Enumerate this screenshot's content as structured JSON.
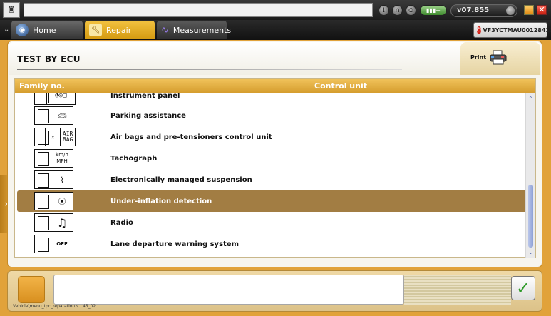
{
  "topbar": {
    "version": "v07.855",
    "close_glyph": "✕"
  },
  "nav": {
    "tabs": [
      {
        "label": "Home"
      },
      {
        "label": "Repair"
      },
      {
        "label": "Measurements"
      }
    ],
    "vin": "VF3YCTMAU00128417"
  },
  "main": {
    "title": "TEST BY ECU",
    "print_label": "Print",
    "columns": [
      "Family no.",
      "Control unit"
    ],
    "rows": [
      {
        "label": "Instrument panel",
        "icon": "instrument-gauge-icon",
        "selected": false
      },
      {
        "label": "Parking assistance",
        "icon": "parking-car-icon",
        "selected": false
      },
      {
        "label": "Air bags and pre-tensioners control unit",
        "icon": "airbag-seat-icon",
        "icon_text": "AIR BAG",
        "selected": false
      },
      {
        "label": "Tachograph",
        "icon": "tachograph-icon",
        "icon_text": "km/h MPH",
        "selected": false
      },
      {
        "label": "Electronically managed suspension",
        "icon": "suspension-spring-icon",
        "selected": false
      },
      {
        "label": "Under-inflation detection",
        "icon": "tyre-pressure-icon",
        "selected": true
      },
      {
        "label": "Radio",
        "icon": "music-note-icon",
        "selected": false
      },
      {
        "label": "Lane departure warning system",
        "icon": "lane-off-icon",
        "icon_text": "OFF",
        "selected": false
      }
    ]
  },
  "bottom": {
    "status_path": "Vehicle\\menu_tpc_reparation.s...45_02",
    "ok_glyph": "✓"
  },
  "colors": {
    "accent": "#e1a23a",
    "selected_row": "#a27d43",
    "header": "#d49b2c"
  }
}
